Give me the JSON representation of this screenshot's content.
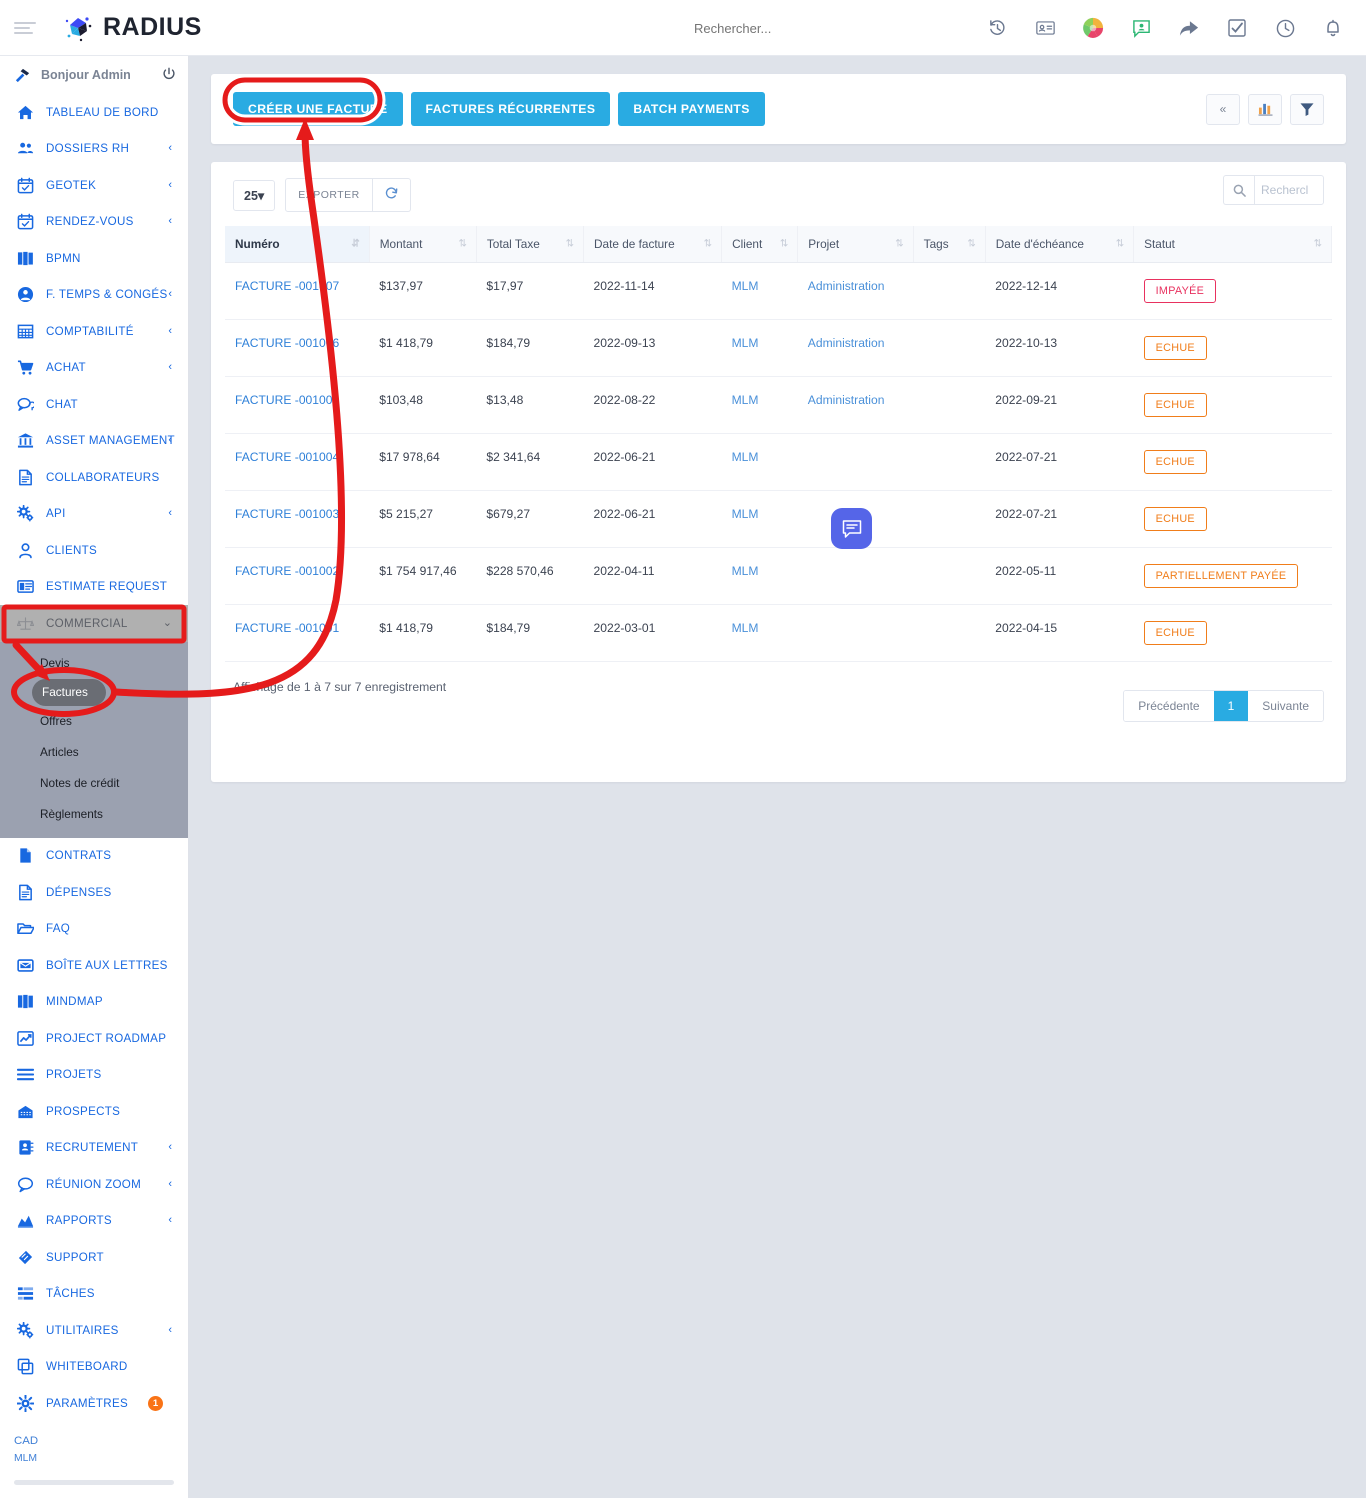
{
  "topbar": {
    "brand": "RADIUS",
    "search_placeholder": "Rechercher...",
    "icons": [
      {
        "name": "history-icon",
        "glyph": "↺"
      },
      {
        "name": "contact-card-icon",
        "glyph": "▤"
      },
      {
        "name": "color-globe-icon",
        "glyph": "◍"
      },
      {
        "name": "chat-user-icon",
        "glyph": "▣"
      },
      {
        "name": "share-arrow-icon",
        "glyph": "➦"
      },
      {
        "name": "checkbox-icon",
        "glyph": "☑"
      },
      {
        "name": "clock-icon",
        "glyph": "◕"
      },
      {
        "name": "bell-icon",
        "glyph": "🔔"
      }
    ]
  },
  "sidebar": {
    "greeting": "Bonjour Admin",
    "items": [
      {
        "label": "TABLEAU DE BORD",
        "icon": "home-icon",
        "chevron": false
      },
      {
        "label": "DOSSIERS RH",
        "icon": "users-icon",
        "chevron": true
      },
      {
        "label": "GEOTEK",
        "icon": "calendar-check-icon",
        "chevron": true
      },
      {
        "label": "RENDEZ-VOUS",
        "icon": "calendar-check-icon",
        "chevron": true
      },
      {
        "label": "BPMN",
        "icon": "book-icon",
        "chevron": false
      },
      {
        "label": "F. TEMPS & CONGÉS",
        "icon": "user-circle-icon",
        "chevron": true
      },
      {
        "label": "COMPTABILITÉ",
        "icon": "grid-icon",
        "chevron": true
      },
      {
        "label": "ACHAT",
        "icon": "cart-icon",
        "chevron": true
      },
      {
        "label": "CHAT",
        "icon": "chat-bubble-icon",
        "chevron": false
      },
      {
        "label": "ASSET MANAGEMENT",
        "icon": "bank-icon",
        "chevron": true
      },
      {
        "label": "COLLABORATEURS",
        "icon": "document-icon",
        "chevron": false
      },
      {
        "label": "API",
        "icon": "gears-icon",
        "chevron": true
      },
      {
        "label": "CLIENTS",
        "icon": "person-icon",
        "chevron": false
      },
      {
        "label": "ESTIMATE REQUEST",
        "icon": "list-card-icon",
        "chevron": false
      }
    ],
    "commercial": {
      "label": "COMMERCIAL",
      "icon": "scales-icon",
      "expanded": true,
      "subitems": [
        {
          "label": "Devis",
          "selected": false
        },
        {
          "label": "Factures",
          "selected": true
        },
        {
          "label": "Offres",
          "selected": false
        },
        {
          "label": "Articles",
          "selected": false
        },
        {
          "label": "Notes de crédit",
          "selected": false
        },
        {
          "label": "Règlements",
          "selected": false
        }
      ]
    },
    "items_after": [
      {
        "label": "CONTRATS",
        "icon": "file-icon",
        "chevron": false
      },
      {
        "label": "DÉPENSES",
        "icon": "document-icon",
        "chevron": false
      },
      {
        "label": "FAQ",
        "icon": "folder-open-icon",
        "chevron": false
      },
      {
        "label": "BOÎTE AUX LETTRES",
        "icon": "mail-icon",
        "chevron": false
      },
      {
        "label": "MINDMAP",
        "icon": "book-icon",
        "chevron": false
      },
      {
        "label": "PROJECT ROADMAP",
        "icon": "chart-line-icon",
        "chevron": false
      },
      {
        "label": "PROJETS",
        "icon": "bars-icon",
        "chevron": false
      },
      {
        "label": "PROSPECTS",
        "icon": "building-icon",
        "chevron": false
      },
      {
        "label": "RECRUTEMENT",
        "icon": "address-book-icon",
        "chevron": true
      },
      {
        "label": "RÉUNION ZOOM",
        "icon": "comment-icon",
        "chevron": true
      },
      {
        "label": "RAPPORTS",
        "icon": "area-chart-icon",
        "chevron": true
      },
      {
        "label": "SUPPORT",
        "icon": "ticket-icon",
        "chevron": false
      },
      {
        "label": "TÂCHES",
        "icon": "tasks-icon",
        "chevron": false
      },
      {
        "label": "UTILITAIRES",
        "icon": "gears-icon",
        "chevron": true
      },
      {
        "label": "WHITEBOARD",
        "icon": "copy-icon",
        "chevron": false
      },
      {
        "label": "PARAMÈTRES",
        "icon": "gear-icon",
        "chevron": false,
        "badge": "1"
      }
    ],
    "currency": "CAD",
    "company": "MLM"
  },
  "actionbar": {
    "buttons": [
      {
        "label": "CRÉER UNE FACTURE",
        "name": "create-invoice-button"
      },
      {
        "label": "FACTURES RÉCURRENTES",
        "name": "recurring-invoices-button"
      },
      {
        "label": "BATCH PAYMENTS",
        "name": "batch-payments-button"
      }
    ],
    "icon_buttons": [
      {
        "name": "collapse-icon",
        "glyph": "«"
      },
      {
        "name": "bar-chart-icon",
        "glyph": "📊"
      },
      {
        "name": "filter-icon",
        "glyph": "▼"
      }
    ]
  },
  "table": {
    "page_length": "25",
    "export_label": "EXPORTER",
    "refresh_icon": "refresh-icon",
    "search_placeholder": "Rechercl",
    "columns": [
      "Numéro",
      "Montant",
      "Total Taxe",
      "Date de facture",
      "Client",
      "Projet",
      "Tags",
      "Date d'échéance",
      "Statut"
    ],
    "rows": [
      {
        "numero": "FACTURE -001007",
        "montant": "$137,97",
        "taxe": "$17,97",
        "date_facture": "2022-11-14",
        "client": "MLM",
        "projet": "Administration",
        "tags": "",
        "echeance": "2022-12-14",
        "statut": "IMPAYÉE",
        "statut_kind": "impayee"
      },
      {
        "numero": "FACTURE -001006",
        "montant": "$1 418,79",
        "taxe": "$184,79",
        "date_facture": "2022-09-13",
        "client": "MLM",
        "projet": "Administration",
        "tags": "",
        "echeance": "2022-10-13",
        "statut": "ECHUE",
        "statut_kind": "echue"
      },
      {
        "numero": "FACTURE -001005",
        "montant": "$103,48",
        "taxe": "$13,48",
        "date_facture": "2022-08-22",
        "client": "MLM",
        "projet": "Administration",
        "tags": "",
        "echeance": "2022-09-21",
        "statut": "ECHUE",
        "statut_kind": "echue"
      },
      {
        "numero": "FACTURE -001004",
        "montant": "$17 978,64",
        "taxe": "$2 341,64",
        "date_facture": "2022-06-21",
        "client": "MLM",
        "projet": "",
        "tags": "",
        "echeance": "2022-07-21",
        "statut": "ECHUE",
        "statut_kind": "echue"
      },
      {
        "numero": "FACTURE -001003",
        "montant": "$5 215,27",
        "taxe": "$679,27",
        "date_facture": "2022-06-21",
        "client": "MLM",
        "projet": "",
        "tags": "",
        "echeance": "2022-07-21",
        "statut": "ECHUE",
        "statut_kind": "echue"
      },
      {
        "numero": "FACTURE -001002",
        "montant": "$1 754 917,46",
        "taxe": "$228 570,46",
        "date_facture": "2022-04-11",
        "client": "MLM",
        "projet": "",
        "tags": "",
        "echeance": "2022-05-11",
        "statut": "PARTIELLEMENT PAYÉE",
        "statut_kind": "partielle"
      },
      {
        "numero": "FACTURE -001001",
        "montant": "$1 418,79",
        "taxe": "$184,79",
        "date_facture": "2022-03-01",
        "client": "MLM",
        "projet": "",
        "tags": "",
        "echeance": "2022-04-15",
        "statut": "ECHUE",
        "statut_kind": "echue"
      }
    ],
    "info": "Affichage de 1 à 7 sur 7 enregistrement",
    "pager": {
      "prev": "Précédente",
      "current": "1",
      "next": "Suivante"
    }
  },
  "chat_fab": {
    "icon": "chat-message-icon"
  },
  "colors": {
    "accent_blue": "#29abe2",
    "link_blue": "#1868e0",
    "annotation_red": "#e51b1b",
    "status_red": "#e8315f",
    "status_orange": "#f07d1a",
    "badge_orange": "#f97316"
  }
}
